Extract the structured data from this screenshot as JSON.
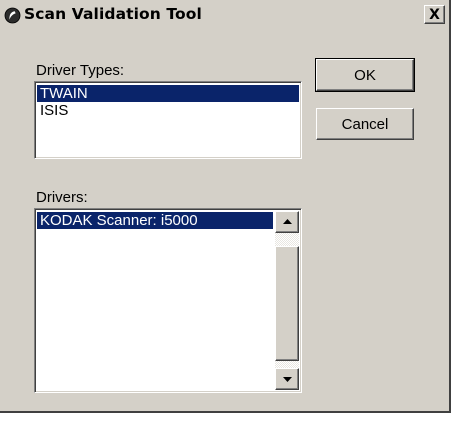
{
  "window": {
    "title": "Scan Validation Tool",
    "close_label": "X"
  },
  "driver_types": {
    "label": "Driver Types:",
    "items": [
      "TWAIN",
      "ISIS"
    ],
    "selected": "TWAIN"
  },
  "drivers": {
    "label": "Drivers:",
    "items": [
      "KODAK Scanner: i5000"
    ],
    "selected": "KODAK Scanner: i5000"
  },
  "buttons": {
    "ok_label": "OK",
    "cancel_label": "Cancel"
  },
  "colors": {
    "window_background": "#d4d0c8",
    "selection": "#0a246a",
    "selection_text": "#ffffff"
  },
  "icons": {
    "title": "app-logo-icon",
    "close": "close-icon",
    "scroll_up": "arrow-up-icon",
    "scroll_down": "arrow-down-icon"
  }
}
